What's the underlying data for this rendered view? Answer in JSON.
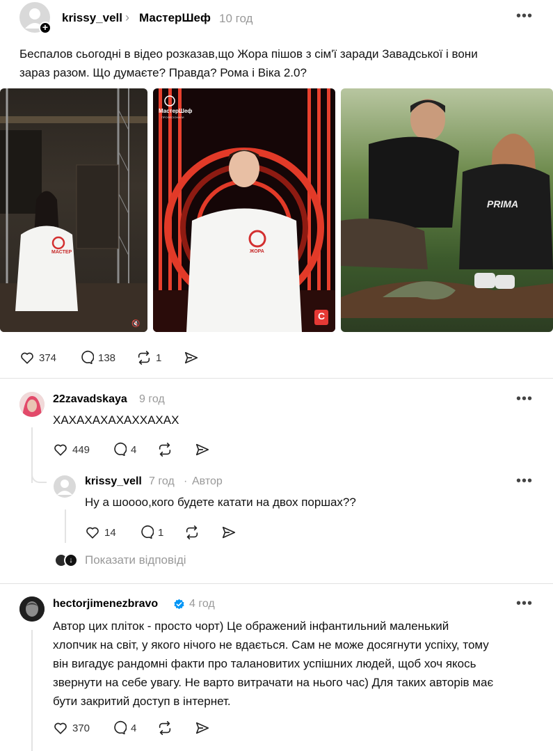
{
  "post": {
    "username": "krissy_vell",
    "community": "МастерШеф",
    "time": "10 год",
    "text_line1": "Беспалов сьогодні в відео розказав,що Жора пішов з сім'ї заради Завадської і вони",
    "text_line2": "зараз разом. Що думаєте? Правда? Рома і Віка 2.0?",
    "likes": "374",
    "comments": "138",
    "reposts": "1",
    "images": [
      {
        "badge": "МАСТЕР"
      },
      {
        "logo": "МастерШеф",
        "logo_sub": "ПРОФЕСІОНАЛИ",
        "badge": "ЖОРА",
        "channel": "С"
      },
      {
        "shirt": "PRIMA"
      }
    ]
  },
  "reply1": {
    "username": "22zavadskaya",
    "time": "9 год",
    "text": "ХАХАХАХАХАХХАХАХ",
    "likes": "449",
    "comments": "4"
  },
  "reply1_1": {
    "username": "krissy_vell",
    "time": "7 год",
    "sep": "·",
    "author_tag": "Автор",
    "text": "Ну а шоооо,кого будете катати на двох поршах??",
    "likes": "14",
    "comments": "1"
  },
  "show_replies": "Показати відповіді",
  "reply2": {
    "username": "hectorjimenezbravo",
    "time": "4 год",
    "lines": [
      "Автор цих пліток - просто чорт) Це ображений інфантильний маленький",
      "хлопчик на світ, у якого нічого не вдається. Сам не може досягнути успіху, тому",
      "він вигадує рандомні факти про талановитих успішних людей, щоб хоч якось",
      "звернути на себе увагу. Не варто витрачати на нього час) Для таких авторів має",
      "бути закритий доступ в інтернет."
    ],
    "likes": "370",
    "comments": "4"
  },
  "colors": {
    "verified": "#0095f6",
    "divider": "#e2e2e2",
    "muted": "#999999",
    "masterchef_red": "#d32f2f"
  }
}
